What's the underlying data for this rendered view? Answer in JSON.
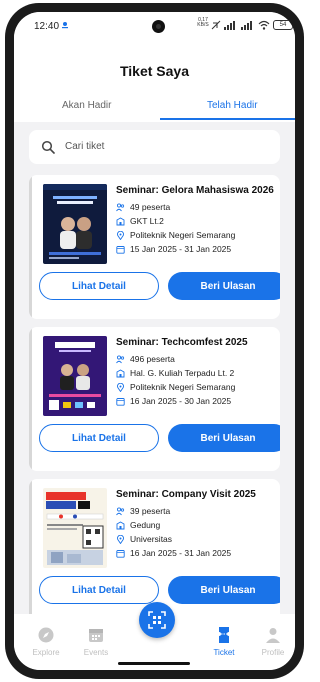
{
  "status_bar": {
    "time": "12:40",
    "network_speed": "0,17 KB/S",
    "battery": "54"
  },
  "header": {
    "title": "Tiket Saya",
    "tabs": [
      {
        "label": "Akan Hadir",
        "active": false
      },
      {
        "label": "Telah Hadir",
        "active": true
      }
    ]
  },
  "search": {
    "placeholder": "Cari tiket"
  },
  "tickets": [
    {
      "title": "Seminar: Gelora Mahasiswa 2026",
      "participants": "49 peserta",
      "room": "GKT Lt.2",
      "venue": "Politeknik Negeri Semarang",
      "date": "15 Jan 2025 - 31 Jan 2025",
      "detail_label": "Lihat Detail",
      "review_label": "Beri Ulasan"
    },
    {
      "title": "Seminar: Techcomfest 2025",
      "participants": "496 peserta",
      "room": "Hal. G. Kuliah Terpadu Lt. 2",
      "venue": "Politeknik Negeri Semarang",
      "date": "16 Jan 2025 - 30 Jan 2025",
      "detail_label": "Lihat Detail",
      "review_label": "Beri Ulasan"
    },
    {
      "title": "Seminar: Company Visit 2025",
      "participants": "39 peserta",
      "room": "Gedung",
      "venue": "Universitas",
      "date": "16 Jan 2025 - 31 Jan 2025",
      "detail_label": "Lihat Detail",
      "review_label": "Beri Ulasan"
    }
  ],
  "bottom_nav": [
    {
      "label": "Explore",
      "icon": "compass-icon",
      "active": false
    },
    {
      "label": "Events",
      "icon": "calendar-icon",
      "active": false
    },
    {
      "label": "Ticket",
      "icon": "ticket-icon",
      "active": true
    },
    {
      "label": "Profile",
      "icon": "person-icon",
      "active": false
    }
  ],
  "scan_button": {
    "icon": "qr-scan-icon"
  },
  "colors": {
    "accent": "#1a73e8",
    "inactive": "#bfbfbf",
    "background": "#f2f2f4"
  }
}
